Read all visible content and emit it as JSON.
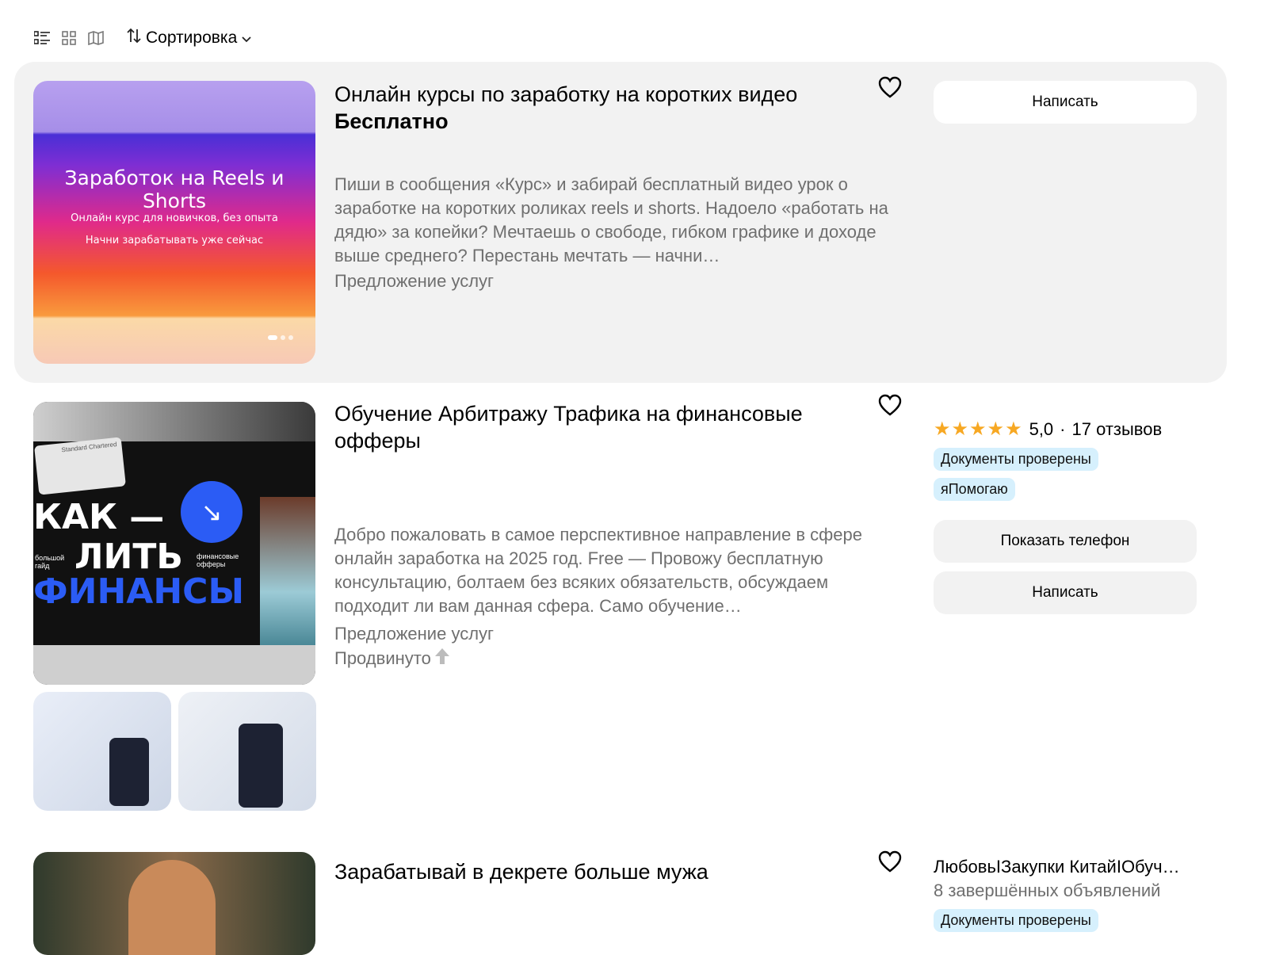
{
  "toolbar": {
    "view_list_icon": "list-view-icon",
    "view_grid_icon": "grid-view-icon",
    "view_map_icon": "map-view-icon",
    "sort_label": "Сортировка"
  },
  "listings": [
    {
      "title": "Онлайн курсы по заработку на коротких видео",
      "price": "Бесплатно",
      "image": {
        "headline": "Заработок на Reels и Shorts",
        "line1": "Онлайн курс для новичков, без опыта",
        "line2": "Начни зарабатывать уже сейчас"
      },
      "description": "Пиши в сообщения «Курс» и забирай бесплатный видео урок о заработке на коротких роликах reels и shorts. Надоело «работать на дядю» за копейки? Мечтаешь о свободе, гибком графике и доходе выше среднего? Перестань мечтать — начни…",
      "category": "Предложение услуг",
      "button": "Написать"
    },
    {
      "title": "Обучение Арбитражу Трафика на финансовые офферы",
      "image": {
        "line_top": "КАК —",
        "line_mid": "ЛИТЬ",
        "line_bottom": "ФИНАНСЫ",
        "left_small": "большой гайд",
        "right_small": "финансовые офферы",
        "card_brand": "Standard Chartered"
      },
      "description": "Добро пожаловать в самое перспективное направление в сфере онлайн заработка на 2025 год. Free — Провожу бесплатную консультацию, болтаем без всяких обязательств, обсуждаем подходит ли вам данная сфера. Само обучение…",
      "category": "Предложение услуг",
      "promoted": "Продвинуто",
      "rating": "5,0",
      "reviews": "17 отзывов",
      "badges": [
        "Документы проверены",
        "яПомогаю"
      ],
      "buttons": [
        "Показать телефон",
        "Написать"
      ]
    },
    {
      "title": "Зарабатывай в декрете больше мужа",
      "seller": "ЛюбовьIЗакупки КитайIОбуч…",
      "seller_stats": "8 завершённых объявлений",
      "badge": "Документы проверены"
    }
  ],
  "colors": {
    "highlight_bg": "#f2f2f2",
    "badge_bg": "#d6f0fd",
    "star": "#f7a823",
    "muted_text": "#6f6f6f"
  }
}
